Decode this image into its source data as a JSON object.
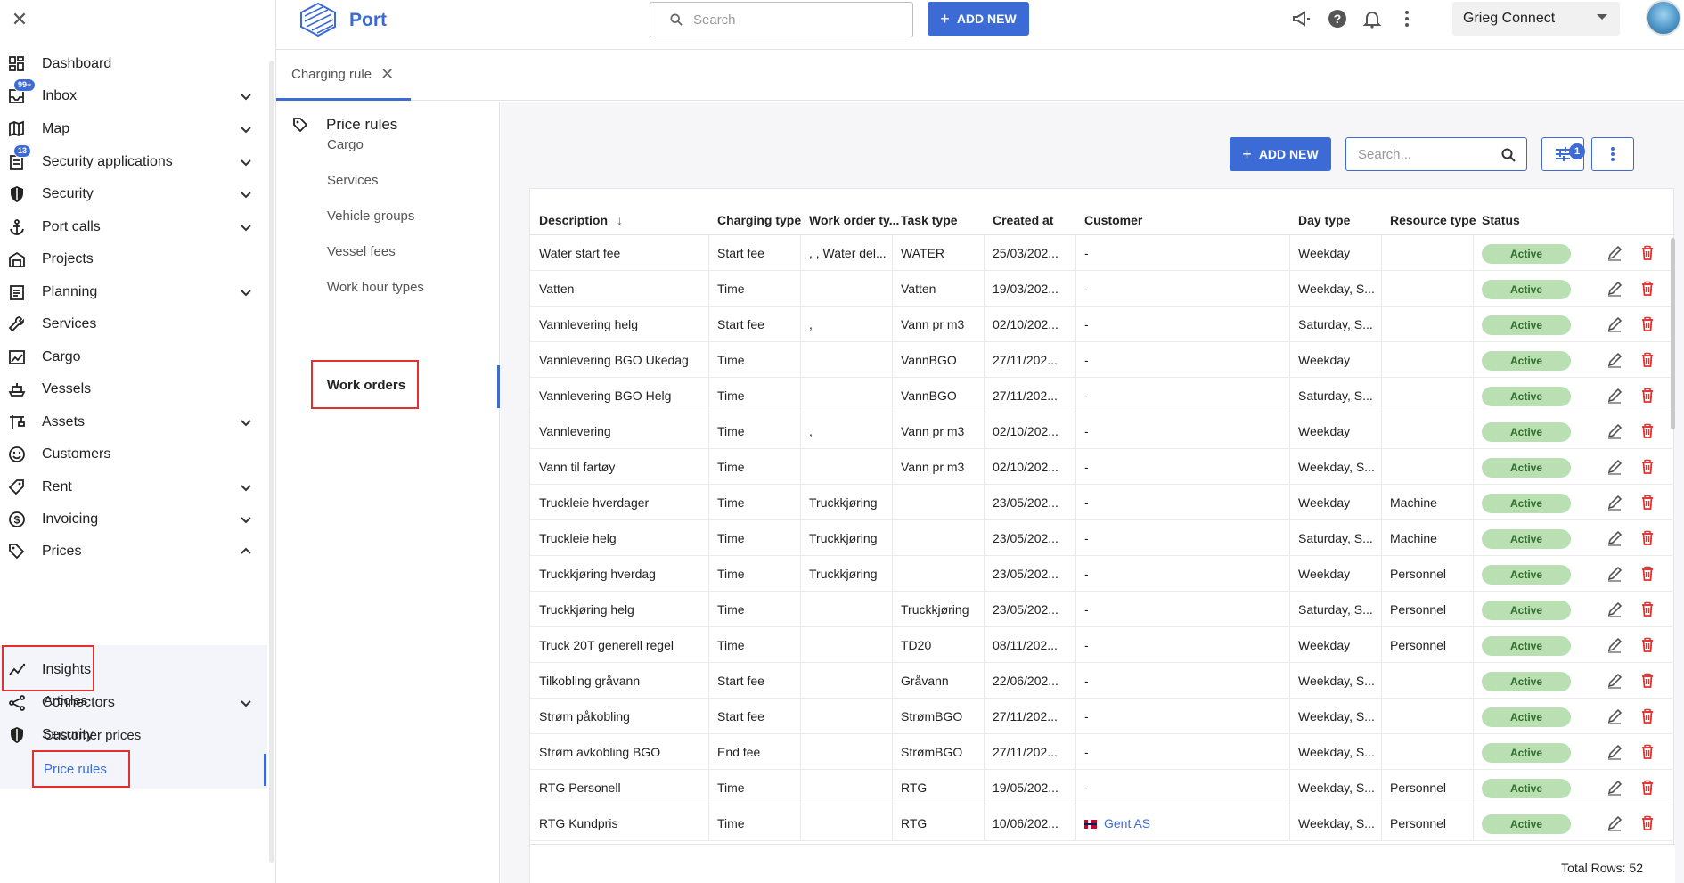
{
  "sidebar": {
    "items": [
      {
        "label": "Dashboard",
        "icon": "dashboard-icon",
        "has_chevron": false
      },
      {
        "label": "Inbox",
        "icon": "inbox-icon",
        "has_chevron": true,
        "badge": "99+"
      },
      {
        "label": "Map",
        "icon": "map-icon",
        "has_chevron": true
      },
      {
        "label": "Security applications",
        "icon": "clipboard-icon",
        "has_chevron": true,
        "badge": "13"
      },
      {
        "label": "Security",
        "icon": "shield-icon",
        "has_chevron": true
      },
      {
        "label": "Port calls",
        "icon": "anchor-icon",
        "has_chevron": true
      },
      {
        "label": "Projects",
        "icon": "warehouse-icon",
        "has_chevron": false
      },
      {
        "label": "Planning",
        "icon": "planning-icon",
        "has_chevron": true
      },
      {
        "label": "Services",
        "icon": "wrench-icon",
        "has_chevron": false
      },
      {
        "label": "Cargo",
        "icon": "cargo-icon",
        "has_chevron": false
      },
      {
        "label": "Vessels",
        "icon": "vessel-icon",
        "has_chevron": false
      },
      {
        "label": "Assets",
        "icon": "crane-icon",
        "has_chevron": true
      },
      {
        "label": "Customers",
        "icon": "customers-icon",
        "has_chevron": false
      },
      {
        "label": "Rent",
        "icon": "rent-icon",
        "has_chevron": true
      },
      {
        "label": "Invoicing",
        "icon": "dollar-icon",
        "has_chevron": true
      },
      {
        "label": "Prices",
        "icon": "tag-icon",
        "has_chevron": true,
        "expanded": true
      },
      {
        "label": "Insights",
        "icon": "insights-icon",
        "has_chevron": false
      },
      {
        "label": "Connectors",
        "icon": "connectors-icon",
        "has_chevron": true
      },
      {
        "label": "Security",
        "icon": "shield-icon",
        "has_chevron": false
      }
    ],
    "prices_sub": [
      "Articles",
      "Customer prices",
      "Price rules"
    ]
  },
  "topbar": {
    "app_name": "Port",
    "search_placeholder": "Search",
    "add_new": "ADD NEW",
    "organization": "Grieg Connect"
  },
  "tab": {
    "label": "Charging rule"
  },
  "subpanel": {
    "title": "Price rules",
    "items": [
      "Cargo",
      "Services",
      "Vehicle groups",
      "Vessel fees",
      "Work hour types",
      "Work orders"
    ],
    "selected": "Work orders"
  },
  "content": {
    "add_new": "ADD NEW",
    "search_placeholder": "Search...",
    "filter_count": "1"
  },
  "table": {
    "headers": {
      "description": "Description",
      "charging_type": "Charging type",
      "work_order_type": "Work order ty...",
      "task_type": "Task type",
      "created_at": "Created at",
      "customer": "Customer",
      "day_type": "Day type",
      "resource_type": "Resource type",
      "status": "Status"
    },
    "rows": [
      {
        "description": "Water start fee",
        "charging_type": "Start fee",
        "work_order_type": ", , Water del...",
        "task_type": "WATER",
        "created_at": "25/03/202...",
        "customer": "-",
        "day_type": "Weekday",
        "resource_type": "",
        "status": "Active"
      },
      {
        "description": "Vatten",
        "charging_type": "Time",
        "work_order_type": "",
        "task_type": "Vatten",
        "created_at": "19/03/202...",
        "customer": "-",
        "day_type": "Weekday, S...",
        "resource_type": "",
        "status": "Active"
      },
      {
        "description": "Vannlevering helg",
        "charging_type": "Start fee",
        "work_order_type": ",",
        "task_type": "Vann pr m3",
        "created_at": "02/10/202...",
        "customer": "-",
        "day_type": "Saturday, S...",
        "resource_type": "",
        "status": "Active"
      },
      {
        "description": "Vannlevering BGO Ukedag",
        "charging_type": "Time",
        "work_order_type": "",
        "task_type": "VannBGO",
        "created_at": "27/11/202...",
        "customer": "-",
        "day_type": "Weekday",
        "resource_type": "",
        "status": "Active"
      },
      {
        "description": "Vannlevering BGO Helg",
        "charging_type": "Time",
        "work_order_type": "",
        "task_type": "VannBGO",
        "created_at": "27/11/202...",
        "customer": "-",
        "day_type": "Saturday, S...",
        "resource_type": "",
        "status": "Active"
      },
      {
        "description": "Vannlevering",
        "charging_type": "Time",
        "work_order_type": ",",
        "task_type": "Vann pr m3",
        "created_at": "02/10/202...",
        "customer": "-",
        "day_type": "Weekday",
        "resource_type": "",
        "status": "Active"
      },
      {
        "description": "Vann til fartøy",
        "charging_type": "Time",
        "work_order_type": "",
        "task_type": "Vann pr m3",
        "created_at": "02/10/202...",
        "customer": "-",
        "day_type": "Weekday, S...",
        "resource_type": "",
        "status": "Active"
      },
      {
        "description": "Truckleie hverdager",
        "charging_type": "Time",
        "work_order_type": "Truckkjøring",
        "task_type": "",
        "created_at": "23/05/202...",
        "customer": "-",
        "day_type": "Weekday",
        "resource_type": "Machine",
        "status": "Active"
      },
      {
        "description": "Truckleie helg",
        "charging_type": "Time",
        "work_order_type": "Truckkjøring",
        "task_type": "",
        "created_at": "23/05/202...",
        "customer": "-",
        "day_type": "Saturday, S...",
        "resource_type": "Machine",
        "status": "Active"
      },
      {
        "description": "Truckkjøring hverdag",
        "charging_type": "Time",
        "work_order_type": "Truckkjøring",
        "task_type": "",
        "created_at": "23/05/202...",
        "customer": "-",
        "day_type": "Weekday",
        "resource_type": "Personnel",
        "status": "Active"
      },
      {
        "description": "Truckkjøring helg",
        "charging_type": "Time",
        "work_order_type": "",
        "task_type": "Truckkjøring",
        "created_at": "23/05/202...",
        "customer": "-",
        "day_type": "Saturday, S...",
        "resource_type": "Personnel",
        "status": "Active"
      },
      {
        "description": "Truck 20T generell regel",
        "charging_type": "Time",
        "work_order_type": "",
        "task_type": "TD20",
        "created_at": "08/11/202...",
        "customer": "-",
        "day_type": "Weekday",
        "resource_type": "Personnel",
        "status": "Active"
      },
      {
        "description": "Tilkobling gråvann",
        "charging_type": "Start fee",
        "work_order_type": "",
        "task_type": "Gråvann",
        "created_at": "22/06/202...",
        "customer": "-",
        "day_type": "Weekday, S...",
        "resource_type": "",
        "status": "Active"
      },
      {
        "description": "Strøm påkobling",
        "charging_type": "Start fee",
        "work_order_type": "",
        "task_type": "StrømBGO",
        "created_at": "27/11/202...",
        "customer": "-",
        "day_type": "Weekday, S...",
        "resource_type": "",
        "status": "Active"
      },
      {
        "description": "Strøm avkobling BGO",
        "charging_type": "End fee",
        "work_order_type": "",
        "task_type": "StrømBGO",
        "created_at": "27/11/202...",
        "customer": "-",
        "day_type": "Weekday, S...",
        "resource_type": "",
        "status": "Active"
      },
      {
        "description": "RTG Personell",
        "charging_type": "Time",
        "work_order_type": "",
        "task_type": "RTG",
        "created_at": "19/05/202...",
        "customer": "-",
        "day_type": "Weekday, S...",
        "resource_type": "Personnel",
        "status": "Active"
      },
      {
        "description": "RTG Kundpris",
        "charging_type": "Time",
        "work_order_type": "",
        "task_type": "RTG",
        "created_at": "10/06/202...",
        "customer": "Gent AS",
        "customer_flag": "norway-flag-icon",
        "day_type": "Weekday, S...",
        "resource_type": "Personnel",
        "status": "Active"
      }
    ],
    "total_rows": "Total Rows: 52"
  },
  "colors": {
    "accent": "#3d6bd6",
    "status_bg": "#b9dfb3",
    "delete": "#e03131",
    "highlight": "#e03131"
  }
}
